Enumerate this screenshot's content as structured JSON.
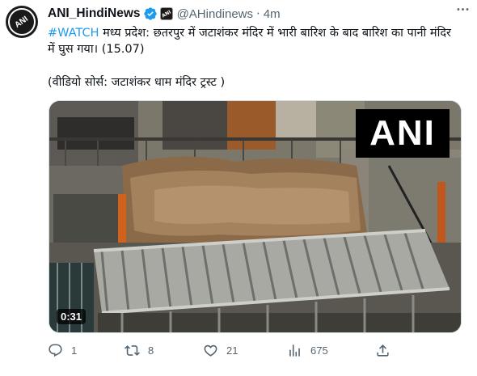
{
  "tweet": {
    "display_name": "ANI_HindiNews",
    "handle": "@AHindinews",
    "separator": "·",
    "time": "4m",
    "avatar_text": "ANI",
    "affiliate_text": "ANI",
    "hashtag": "#WATCH",
    "text": " मध्य प्रदेश: छतरपुर में जटाशंकर मंदिर में भारी बारिश के बाद बारिश का पानी मंदिर में घुस गया। (15.07)",
    "source": "(वीडियो सोर्स: जटाशंकर धाम मंदिर ट्रस्ट )"
  },
  "media": {
    "logo_text": "ANI",
    "duration": "0:31"
  },
  "actions": {
    "replies": "1",
    "retweets": "8",
    "likes": "21",
    "views": "675"
  },
  "colors": {
    "accent": "#1d9bf0",
    "muted": "#536471",
    "text": "#0f1419"
  }
}
